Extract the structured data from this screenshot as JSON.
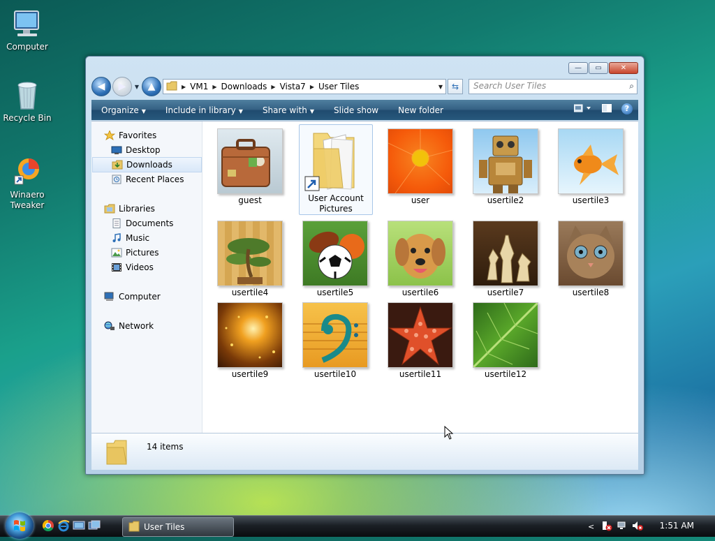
{
  "desktop": {
    "icons": [
      {
        "label": "Computer"
      },
      {
        "label": "Recycle Bin"
      },
      {
        "label": "Winaero Tweaker"
      }
    ]
  },
  "window": {
    "title_buttons": {
      "minimize": "—",
      "maximize": "▭",
      "close": "✕"
    },
    "address": {
      "segments": [
        "VM1",
        "Downloads",
        "Vista7",
        "User Tiles"
      ]
    },
    "search": {
      "placeholder": "Search User Tiles"
    },
    "toolbar": {
      "organize": "Organize",
      "include_in_library": "Include in library",
      "share_with": "Share with",
      "slide_show": "Slide show",
      "new_folder": "New folder"
    },
    "sidebar": {
      "favorites": {
        "label": "Favorites",
        "items": [
          "Desktop",
          "Downloads",
          "Recent Places"
        ]
      },
      "libraries": {
        "label": "Libraries",
        "items": [
          "Documents",
          "Music",
          "Pictures",
          "Videos"
        ]
      },
      "computer": "Computer",
      "network": "Network",
      "selected": "Downloads"
    },
    "files": [
      {
        "name": "guest"
      },
      {
        "name": "User Account Pictures"
      },
      {
        "name": "user"
      },
      {
        "name": "usertile2"
      },
      {
        "name": "usertile3"
      },
      {
        "name": "usertile4"
      },
      {
        "name": "usertile5"
      },
      {
        "name": "usertile6"
      },
      {
        "name": "usertile7"
      },
      {
        "name": "usertile8"
      },
      {
        "name": "usertile9"
      },
      {
        "name": "usertile10"
      },
      {
        "name": "usertile11"
      },
      {
        "name": "usertile12"
      }
    ],
    "details": {
      "item_count": "14 items"
    }
  },
  "taskbar": {
    "window_button": "User Tiles",
    "clock": "1:51 AM"
  }
}
